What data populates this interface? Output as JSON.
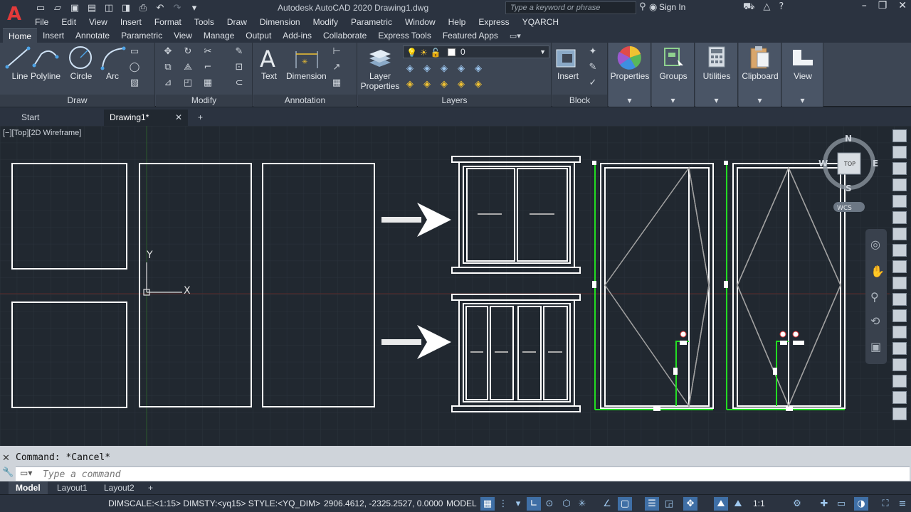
{
  "title": "Autodesk AutoCAD 2020   Drawing1.dwg",
  "search_placeholder": "Type a keyword or phrase",
  "sign_in": "Sign In",
  "menu": [
    "File",
    "Edit",
    "View",
    "Insert",
    "Format",
    "Tools",
    "Draw",
    "Dimension",
    "Modify",
    "Parametric",
    "Window",
    "Help",
    "Express",
    "YQARCH"
  ],
  "ribbon_tabs": [
    "Home",
    "Insert",
    "Annotate",
    "Parametric",
    "View",
    "Manage",
    "Output",
    "Add-ins",
    "Collaborate",
    "Express Tools",
    "Featured Apps"
  ],
  "active_ribbon_tab": "Home",
  "panels": {
    "draw": {
      "title": "Draw",
      "line": "Line",
      "polyline": "Polyline",
      "circle": "Circle",
      "arc": "Arc"
    },
    "modify": {
      "title": "Modify"
    },
    "annotation": {
      "title": "Annotation",
      "text": "Text",
      "dimension": "Dimension"
    },
    "layers": {
      "title": "Layers",
      "layer_properties": "Layer Properties",
      "current_layer": "0"
    },
    "block": {
      "title": "Block",
      "insert": "Insert"
    },
    "properties": "Properties",
    "groups": "Groups",
    "utilities": "Utilities",
    "clipboard": "Clipboard",
    "view": "View"
  },
  "file_tabs": [
    {
      "label": "Start"
    },
    {
      "label": "Drawing1*"
    }
  ],
  "viewport_label": "[−][Top][2D Wireframe]",
  "viewcube": {
    "n": "N",
    "s": "S",
    "e": "E",
    "w": "W",
    "face": "TOP",
    "ucs": "WCS"
  },
  "ucs_icon": {
    "x": "X",
    "y": "Y"
  },
  "command": {
    "history": "Command: *Cancel*",
    "placeholder": "Type a command"
  },
  "layout_tabs": [
    "Model",
    "Layout1",
    "Layout2"
  ],
  "status": {
    "dim_info": "DIMSCALE:<1:15> DIMSTY:<yq15> STYLE:<YQ_DIM>",
    "coords": "2906.4612, -2325.2527, 0.0000",
    "space": "MODEL",
    "scale": "1:1"
  },
  "colors": {
    "accent": "#3f6fa6",
    "canvas": "#212830",
    "selection": "#22dd22"
  }
}
